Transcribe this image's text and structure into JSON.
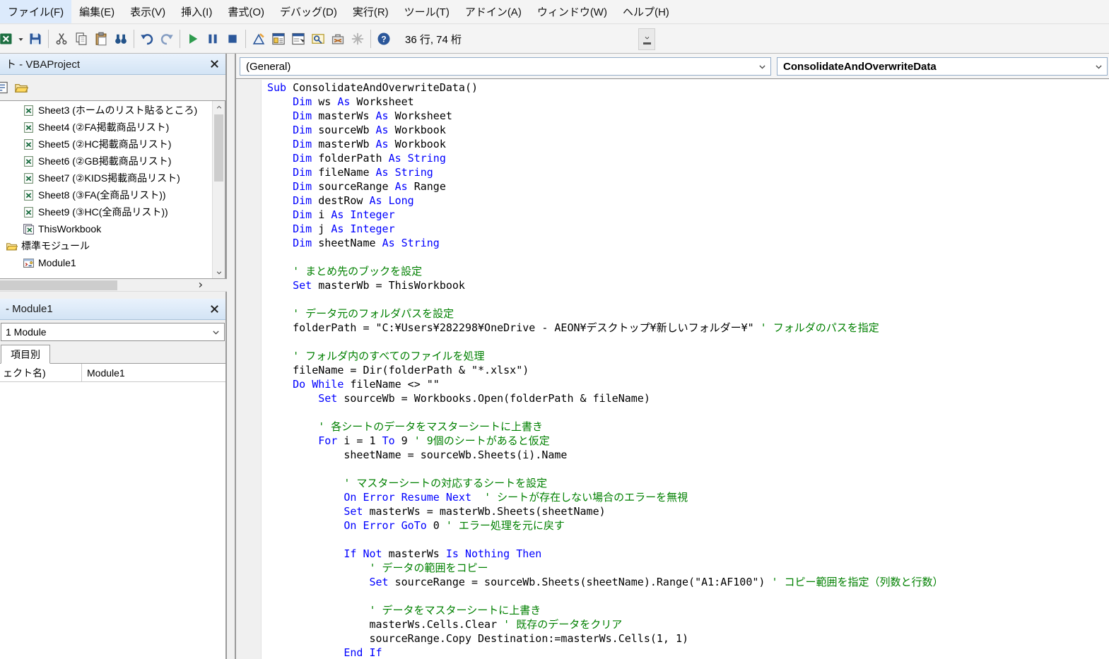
{
  "colors": {
    "keyword": "#0000ff",
    "comment": "#008000",
    "titlebar": "#d9e6f4",
    "run_green": "#2e9b4e"
  },
  "window": {
    "menu": [
      "ファイル(F)",
      "編集(E)",
      "表示(V)",
      "挿入(I)",
      "書式(O)",
      "デバッグ(D)",
      "実行(R)",
      "ツール(T)",
      "アドイン(A)",
      "ウィンドウ(W)",
      "ヘルプ(H)"
    ],
    "toolbar": {
      "position_status": "36 行, 74 桁",
      "icons": [
        {
          "name": "excel-view-icon"
        },
        {
          "name": "dropdown-caret-icon",
          "narrow": true
        },
        {
          "name": "save-icon"
        },
        {
          "name": "separator"
        },
        {
          "name": "cut-icon"
        },
        {
          "name": "copy-icon"
        },
        {
          "name": "paste-icon"
        },
        {
          "name": "find-icon"
        },
        {
          "name": "separator"
        },
        {
          "name": "undo-icon"
        },
        {
          "name": "redo-icon"
        },
        {
          "name": "separator"
        },
        {
          "name": "run-icon"
        },
        {
          "name": "pause-icon"
        },
        {
          "name": "stop-icon"
        },
        {
          "name": "separator"
        },
        {
          "name": "design-mode-icon"
        },
        {
          "name": "project-explorer-icon"
        },
        {
          "name": "properties-window-icon"
        },
        {
          "name": "object-browser-icon"
        },
        {
          "name": "toolbox-icon"
        },
        {
          "name": "control-wizards-icon"
        },
        {
          "name": "separator"
        },
        {
          "name": "help-icon"
        }
      ]
    }
  },
  "project_panel": {
    "title": "ト - VBAProject",
    "toolbar": [
      {
        "name": "view-code-icon"
      },
      {
        "name": "toggle-folders-icon"
      }
    ],
    "tree": [
      {
        "icon": "sheet-icon",
        "label": "Sheet3 (ホームのリスト貼るところ)",
        "indent": 1
      },
      {
        "icon": "sheet-icon",
        "label": "Sheet4 (②FA掲載商品リスト)",
        "indent": 1
      },
      {
        "icon": "sheet-icon",
        "label": "Sheet5 (②HC掲載商品リスト)",
        "indent": 1
      },
      {
        "icon": "sheet-icon",
        "label": "Sheet6 (②GB掲載商品リスト)",
        "indent": 1
      },
      {
        "icon": "sheet-icon",
        "label": "Sheet7 (②KIDS掲載商品リスト)",
        "indent": 1
      },
      {
        "icon": "sheet-icon",
        "label": "Sheet8 (③FA(全商品リスト))",
        "indent": 1
      },
      {
        "icon": "sheet-icon",
        "label": "Sheet9 (③HC(全商品リスト))",
        "indent": 1
      },
      {
        "icon": "workbook-icon",
        "label": "ThisWorkbook",
        "indent": 1
      },
      {
        "icon": "folder-icon",
        "label": "標準モジュール",
        "indent": 0
      },
      {
        "icon": "module-icon",
        "label": "Module1",
        "indent": 1
      }
    ]
  },
  "properties_panel": {
    "title": "- Module1",
    "object_selector": "1 Module",
    "tab": "項目別",
    "rows": [
      {
        "name": "ェクト名)",
        "value": "Module1"
      }
    ]
  },
  "code_window": {
    "object_box": "(General)",
    "procedure_box": "ConsolidateAndOverwriteData",
    "lines": [
      [
        [
          "k",
          "Sub"
        ],
        [
          "n",
          " ConsolidateAndOverwriteData()"
        ]
      ],
      [
        [
          "n",
          "    "
        ],
        [
          "k",
          "Dim"
        ],
        [
          "n",
          " ws "
        ],
        [
          "k",
          "As"
        ],
        [
          "n",
          " Worksheet"
        ]
      ],
      [
        [
          "n",
          "    "
        ],
        [
          "k",
          "Dim"
        ],
        [
          "n",
          " masterWs "
        ],
        [
          "k",
          "As"
        ],
        [
          "n",
          " Worksheet"
        ]
      ],
      [
        [
          "n",
          "    "
        ],
        [
          "k",
          "Dim"
        ],
        [
          "n",
          " sourceWb "
        ],
        [
          "k",
          "As"
        ],
        [
          "n",
          " Workbook"
        ]
      ],
      [
        [
          "n",
          "    "
        ],
        [
          "k",
          "Dim"
        ],
        [
          "n",
          " masterWb "
        ],
        [
          "k",
          "As"
        ],
        [
          "n",
          " Workbook"
        ]
      ],
      [
        [
          "n",
          "    "
        ],
        [
          "k",
          "Dim"
        ],
        [
          "n",
          " folderPath "
        ],
        [
          "k",
          "As String"
        ]
      ],
      [
        [
          "n",
          "    "
        ],
        [
          "k",
          "Dim"
        ],
        [
          "n",
          " fileName "
        ],
        [
          "k",
          "As String"
        ]
      ],
      [
        [
          "n",
          "    "
        ],
        [
          "k",
          "Dim"
        ],
        [
          "n",
          " sourceRange "
        ],
        [
          "k",
          "As"
        ],
        [
          "n",
          " Range"
        ]
      ],
      [
        [
          "n",
          "    "
        ],
        [
          "k",
          "Dim"
        ],
        [
          "n",
          " destRow "
        ],
        [
          "k",
          "As Long"
        ]
      ],
      [
        [
          "n",
          "    "
        ],
        [
          "k",
          "Dim"
        ],
        [
          "n",
          " i "
        ],
        [
          "k",
          "As Integer"
        ]
      ],
      [
        [
          "n",
          "    "
        ],
        [
          "k",
          "Dim"
        ],
        [
          "n",
          " j "
        ],
        [
          "k",
          "As Integer"
        ]
      ],
      [
        [
          "n",
          "    "
        ],
        [
          "k",
          "Dim"
        ],
        [
          "n",
          " sheetName "
        ],
        [
          "k",
          "As String"
        ]
      ],
      [],
      [
        [
          "c",
          "    ' まとめ先のブックを設定"
        ]
      ],
      [
        [
          "n",
          "    "
        ],
        [
          "k",
          "Set"
        ],
        [
          "n",
          " masterWb = ThisWorkbook"
        ]
      ],
      [],
      [
        [
          "c",
          "    ' データ元のフォルダパスを設定"
        ]
      ],
      [
        [
          "n",
          "    folderPath = \"C:¥Users¥282298¥OneDrive - AEON¥デスクトップ¥新しいフォルダー¥\" "
        ],
        [
          "c",
          "' フォルダのパスを指定"
        ]
      ],
      [],
      [
        [
          "c",
          "    ' フォルダ内のすべてのファイルを処理"
        ]
      ],
      [
        [
          "n",
          "    fileName = Dir(folderPath & \"*.xlsx\")"
        ]
      ],
      [
        [
          "n",
          "    "
        ],
        [
          "k",
          "Do While"
        ],
        [
          "n",
          " fileName <> \"\""
        ]
      ],
      [
        [
          "n",
          "        "
        ],
        [
          "k",
          "Set"
        ],
        [
          "n",
          " sourceWb = Workbooks.Open(folderPath & fileName)"
        ]
      ],
      [],
      [
        [
          "c",
          "        ' 各シートのデータをマスターシートに上書き"
        ]
      ],
      [
        [
          "n",
          "        "
        ],
        [
          "k",
          "For"
        ],
        [
          "n",
          " i = 1 "
        ],
        [
          "k",
          "To"
        ],
        [
          "n",
          " 9 "
        ],
        [
          "c",
          "' 9個のシートがあると仮定"
        ]
      ],
      [
        [
          "n",
          "            sheetName = sourceWb.Sheets(i).Name"
        ]
      ],
      [],
      [
        [
          "c",
          "            ' マスターシートの対応するシートを設定"
        ]
      ],
      [
        [
          "n",
          "            "
        ],
        [
          "k",
          "On Error Resume Next"
        ],
        [
          "n",
          "  "
        ],
        [
          "c",
          "' シートが存在しない場合のエラーを無視"
        ]
      ],
      [
        [
          "n",
          "            "
        ],
        [
          "k",
          "Set"
        ],
        [
          "n",
          " masterWs = masterWb.Sheets(sheetName)"
        ]
      ],
      [
        [
          "n",
          "            "
        ],
        [
          "k",
          "On Error GoTo"
        ],
        [
          "n",
          " 0 "
        ],
        [
          "c",
          "' エラー処理を元に戻す"
        ]
      ],
      [],
      [
        [
          "n",
          "            "
        ],
        [
          "k",
          "If Not"
        ],
        [
          "n",
          " masterWs "
        ],
        [
          "k",
          "Is Nothing Then"
        ]
      ],
      [
        [
          "c",
          "                ' データの範囲をコピー"
        ]
      ],
      [
        [
          "n",
          "                "
        ],
        [
          "k",
          "Set"
        ],
        [
          "n",
          " sourceRange = sourceWb.Sheets(sheetName).Range(\"A1:AF100\") "
        ],
        [
          "c",
          "' コピー範囲を指定（列数と行数）"
        ]
      ],
      [],
      [
        [
          "c",
          "                ' データをマスターシートに上書き"
        ]
      ],
      [
        [
          "n",
          "                masterWs.Cells.Clear "
        ],
        [
          "c",
          "' 既存のデータをクリア"
        ]
      ],
      [
        [
          "n",
          "                sourceRange.Copy Destination:=masterWs.Cells(1, 1)"
        ]
      ],
      [
        [
          "n",
          "            "
        ],
        [
          "k",
          "End If"
        ]
      ]
    ]
  }
}
